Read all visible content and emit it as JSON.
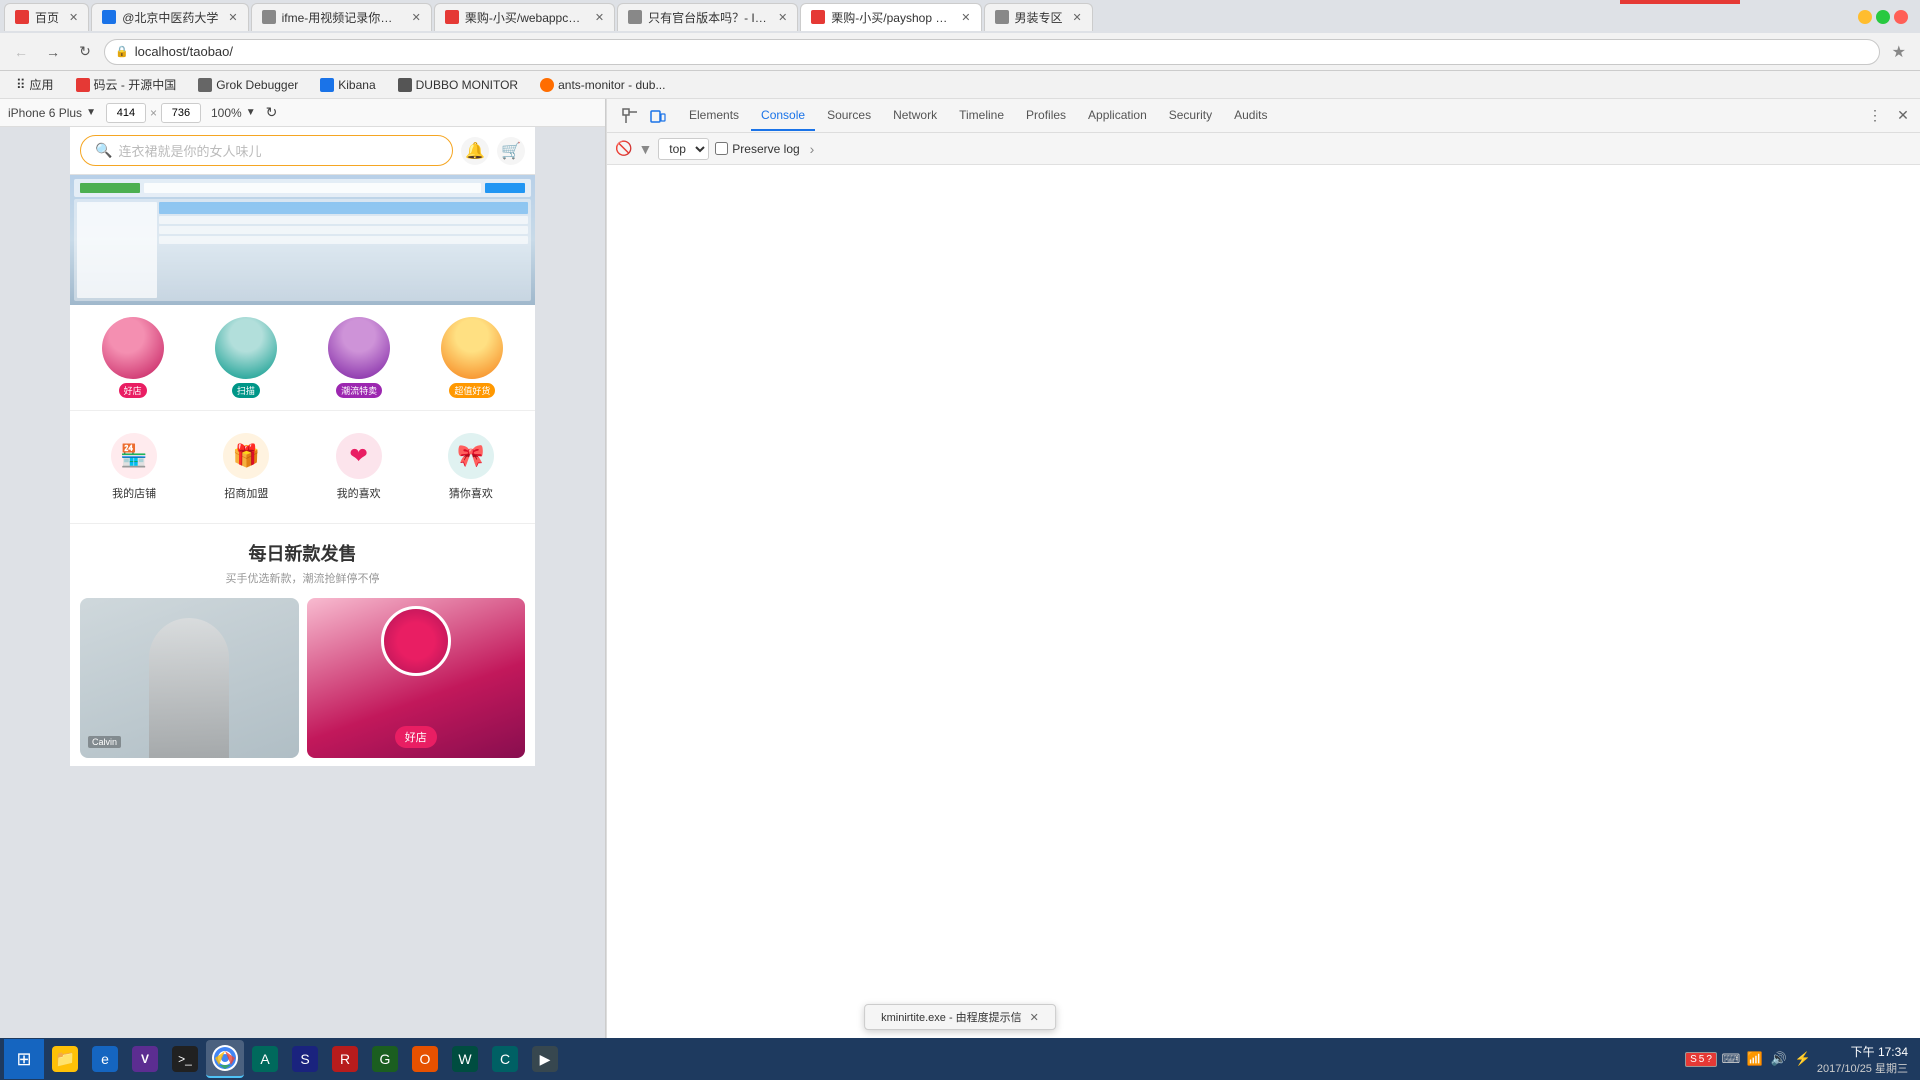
{
  "browser": {
    "tabs": [
      {
        "id": "tab1",
        "favicon_color": "red",
        "title": "百页",
        "active": false
      },
      {
        "id": "tab2",
        "favicon_color": "blue",
        "title": "@北京中医药大学",
        "active": false
      },
      {
        "id": "tab3",
        "favicon_color": "gray",
        "title": "ifme-用视频记录你的生...",
        "active": false
      },
      {
        "id": "tab4",
        "favicon_color": "red",
        "title": "栗购-小买/webappchat...",
        "active": false
      },
      {
        "id": "tab5",
        "favicon_color": "gray",
        "title": "只有官台版本吗？- Issu...",
        "active": false
      },
      {
        "id": "tab6",
        "favicon_color": "red",
        "title": "栗购-小买/payshop -看...",
        "active": true
      },
      {
        "id": "tab7",
        "favicon_color": "gray",
        "title": "男装专区",
        "active": false
      }
    ],
    "address": "localhost/taobao/",
    "bookmarks": [
      {
        "label": "应用",
        "icon": "apps"
      },
      {
        "label": "码云 - 开源中国",
        "icon": "cloud"
      },
      {
        "label": "Grok Debugger",
        "icon": "bug"
      },
      {
        "label": "Kibana",
        "icon": "kibana"
      },
      {
        "label": "DUBBO MONITOR",
        "icon": "monitor"
      },
      {
        "label": "ants-monitor - dub...",
        "icon": "ant"
      }
    ]
  },
  "mobile_preview": {
    "device": "iPhone 6 Plus",
    "width": "414",
    "height": "736",
    "zoom": "100%",
    "taobao": {
      "search_placeholder": "连衣裙就是你的女人味儿",
      "categories": [
        {
          "label": "好店",
          "badge_color": "red"
        },
        {
          "label": "扫描",
          "badge_color": "teal"
        },
        {
          "label": "潮流特卖",
          "badge_color": "purple"
        },
        {
          "label": "超值好货",
          "badge_color": "orange"
        }
      ],
      "icons": [
        {
          "label": "我的店铺",
          "icon": "🏪",
          "color": "red"
        },
        {
          "label": "招商加盟",
          "icon": "🎁",
          "color": "orange"
        },
        {
          "label": "我的喜欢",
          "icon": "❤",
          "color": "pink"
        },
        {
          "label": "猜你喜欢",
          "icon": "🎀",
          "color": "teal"
        }
      ],
      "new_section_title": "每日新款发售",
      "new_section_subtitle": "买手优选新款，潮流抢鲜停不停",
      "good_store_label": "好店"
    }
  },
  "devtools": {
    "tabs": [
      {
        "id": "elements",
        "label": "Elements",
        "active": false
      },
      {
        "id": "console",
        "label": "Console",
        "active": true
      },
      {
        "id": "sources",
        "label": "Sources",
        "active": false
      },
      {
        "id": "network",
        "label": "Network",
        "active": false
      },
      {
        "id": "timeline",
        "label": "Timeline",
        "active": false
      },
      {
        "id": "profiles",
        "label": "Profiles",
        "active": false
      },
      {
        "id": "application",
        "label": "Application",
        "active": false
      },
      {
        "id": "security",
        "label": "Security",
        "active": false
      },
      {
        "id": "audits",
        "label": "Audits",
        "active": false
      }
    ],
    "console_bar": {
      "top_label": "top",
      "preserve_log": "Preserve log"
    }
  },
  "taskbar": {
    "time": "下午 17:34",
    "date": "2017/10/25 星期三",
    "items": [
      {
        "id": "start",
        "icon": "⊞"
      },
      {
        "id": "explorer",
        "icon": "📁"
      },
      {
        "id": "ie",
        "icon": "🌐"
      },
      {
        "id": "visual",
        "icon": "V"
      },
      {
        "id": "cmd",
        "icon": ">"
      },
      {
        "id": "chrome",
        "icon": "●"
      },
      {
        "id": "app1",
        "icon": "A"
      },
      {
        "id": "app2",
        "icon": "S"
      }
    ],
    "kminirtite_label": "kminirtite.exe - 由程度提示信"
  }
}
